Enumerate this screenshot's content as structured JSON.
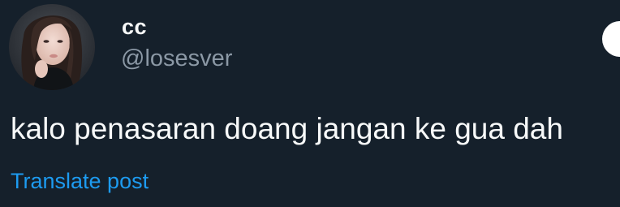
{
  "post": {
    "author": {
      "display_name": "cc",
      "handle": "@losesver",
      "avatar": "profile-photo"
    },
    "text": "kalo penasaran doang jangan ke gua dah",
    "translate_label": "Translate post"
  },
  "colors": {
    "background": "#15202b",
    "primary_text": "#f7f9f9",
    "secondary_text": "#8b98a5",
    "link": "#1d9bf0"
  }
}
